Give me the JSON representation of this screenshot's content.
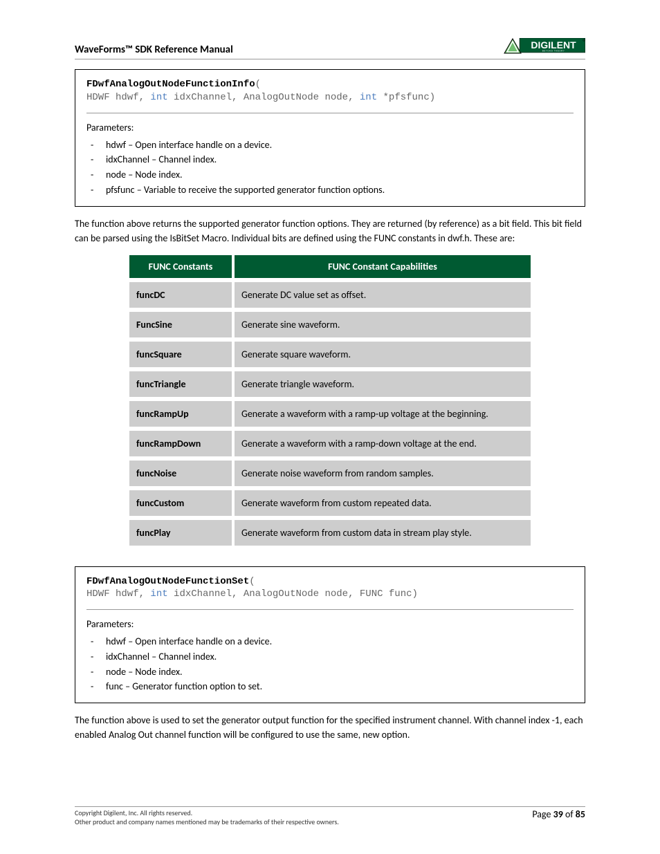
{
  "header": {
    "title": "WaveForms™ SDK Reference Manual",
    "logo_text": "DIGILENT",
    "logo_sub": "BEYOND THEORY"
  },
  "block1": {
    "fn": "FDwfAnalogOutNodeFunctionInfo",
    "sig_a": "HDWF hdwf, ",
    "sig_b": " idxChannel, AnalogOutNode node, ",
    "sig_c": " *pfsfunc)",
    "kw": "int",
    "params_label": "Parameters:",
    "params": [
      "hdwf – Open interface handle on a device.",
      "idxChannel – Channel index.",
      "node – Node index.",
      "pfsfunc – Variable to receive the supported generator function options."
    ]
  },
  "para1": "The function above returns the supported generator function options. They are returned (by reference) as a bit field. This bit field can be parsed using the IsBitSet Macro. Individual bits are defined using the FUNC constants in dwf.h.  These are:",
  "table": {
    "h1": "FUNC Constants",
    "h2": "FUNC Constant Capabilities",
    "rows": [
      {
        "c": "funcDC",
        "d": "Generate DC value set as offset."
      },
      {
        "c": "FuncSine",
        "d": "Generate sine waveform."
      },
      {
        "c": "funcSquare",
        "d": "Generate square waveform."
      },
      {
        "c": "funcTriangle",
        "d": "Generate triangle waveform."
      },
      {
        "c": "funcRampUp",
        "d": "Generate a waveform with a ramp-up voltage at the beginning."
      },
      {
        "c": "funcRampDown",
        "d": "Generate a waveform with a ramp-down voltage at the end."
      },
      {
        "c": "funcNoise",
        "d": "Generate noise waveform from random samples."
      },
      {
        "c": "funcCustom",
        "d": "Generate waveform from custom repeated data."
      },
      {
        "c": "funcPlay",
        "d": "Generate waveform from custom data in stream play style."
      }
    ]
  },
  "block2": {
    "fn": "FDwfAnalogOutNodeFunctionSet",
    "sig_a": "HDWF hdwf, ",
    "sig_b": " idxChannel, AnalogOutNode node, FUNC func)",
    "kw": "int",
    "params_label": "Parameters:",
    "params": [
      "hdwf – Open interface handle on a device.",
      "idxChannel – Channel index.",
      "node – Node index.",
      "func – Generator function option to set."
    ]
  },
  "para2": "The function above is used to set the generator output function for the specified instrument channel. With channel index -1, each enabled Analog Out channel function will be configured to use the same, new option.",
  "footer": {
    "line1": "Copyright Digilent, Inc. All rights reserved.",
    "line2": "Other product and company names mentioned may be trademarks of their respective owners.",
    "page_label": "Page ",
    "page_num": "39",
    "page_of": " of ",
    "page_total": "85"
  }
}
